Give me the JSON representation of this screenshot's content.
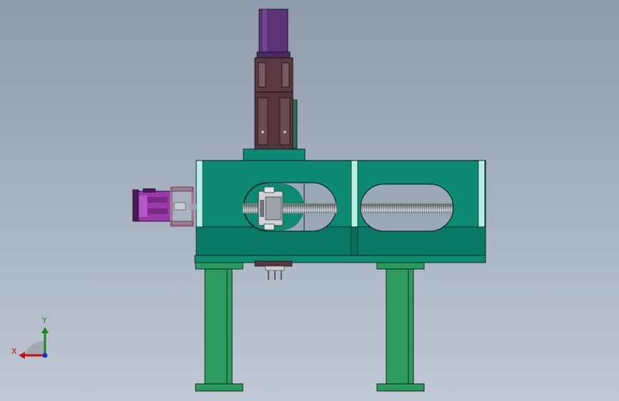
{
  "viewport": {
    "background_top": "#8e9bac",
    "background_bottom": "#bfc8d4"
  },
  "model": {
    "colors": {
      "frame_green": "#0c8a73",
      "frame_dark": "#0a6e5b",
      "frame_outline": "#0b2a22",
      "leg_green": "#2e9b5e",
      "rail_highlight": "#b6eee6",
      "motor_purple": "#5c3478",
      "cylinder_brown": "#5a3a40",
      "side_motor_magenta": "#9a3aa8",
      "screw_steel": "#8a8f95",
      "bracket_mauve": "#a07a90"
    }
  },
  "triad": {
    "x_label": "X",
    "y_label": "Y",
    "x_color": "#cc1111",
    "y_color": "#1a8a1a",
    "z_color": "#1133cc"
  }
}
